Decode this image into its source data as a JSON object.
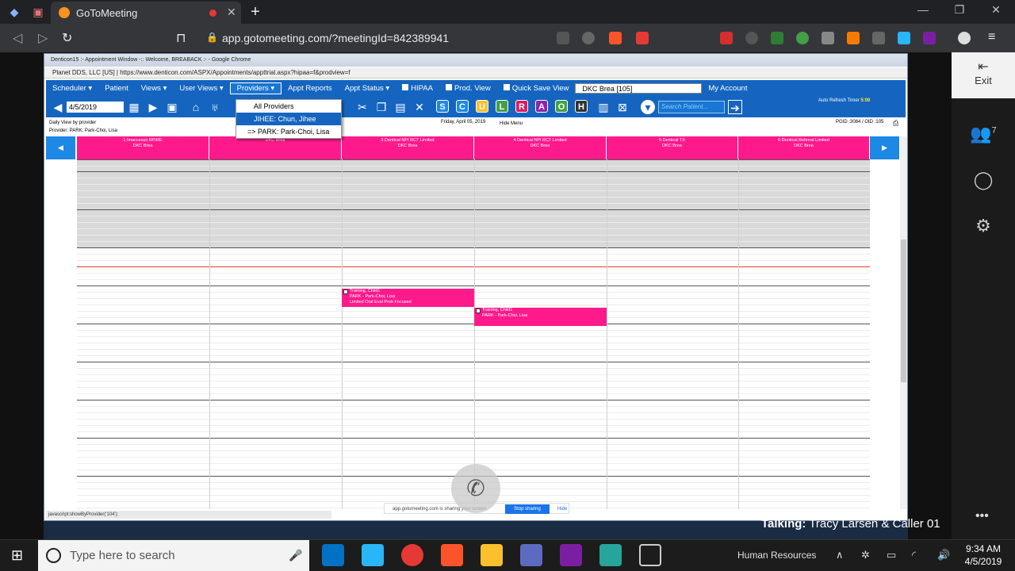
{
  "browser": {
    "tab_title": "GoToMeeting",
    "url": "app.gotomeeting.com/?meetingId=842389941"
  },
  "shared_window": {
    "title": "Denticon15 :- Appointment Window -:: Welcome, BREABACK :- - Google Chrome",
    "url": "Planet DDS, LLC [US]  |  https://www.denticon.com/ASPX/Appointments/appttrial.aspx?hipaa=f&prodview=f",
    "menu": {
      "scheduler": "Scheduler ▾",
      "patient": "Patient",
      "views": "Views ▾",
      "user_views": "User Views ▾",
      "providers": "Providers ▾",
      "appt_reports": "Appt Reports",
      "appt_status": "Appt Status ▾",
      "hipaa": "HIPAA",
      "prod_view": "Prod. View",
      "quick_save": "Quick Save View",
      "location": "DKC Brea [105]",
      "my_account": "My Account"
    },
    "toolbar": {
      "date": "4/5/2019",
      "search_placeholder": "Search Patient...",
      "auto_refresh_label": "Auto Refresh Timer",
      "auto_refresh_value": "5:00",
      "letters": [
        "S",
        "C",
        "U",
        "L",
        "R",
        "A",
        "O",
        "H"
      ]
    },
    "providers_dropdown": {
      "items": [
        "All Providers",
        "JIHEE: Chun, Jihee",
        "=> PARK: Park-Choi, Lisa"
      ],
      "highlighted_index": 1
    },
    "info": {
      "view": "Daily View by provider",
      "provider": "Provider: PARK: Park-Choi, Lisa",
      "date": "Friday, April 05, 2019",
      "hide_menu": "Hide Menu",
      "pgid": "PGID :3084 / OID :105"
    },
    "columns": [
      {
        "name": "1 Imaccesso NPIRE",
        "loc": "DKC Brea"
      },
      {
        "name": "",
        "loc": "DKC Brea"
      },
      {
        "name": "3 Dentical NPI RCT Limited",
        "loc": "DKC Brea"
      },
      {
        "name": "4 Dentical NPI RCT Limited",
        "loc": "DKC Brea"
      },
      {
        "name": "5 Dentical TX",
        "loc": "DKC Brea"
      },
      {
        "name": "6 Dentical Referral Limited",
        "loc": "DKC Brea"
      }
    ],
    "appointments": [
      {
        "line1": "Training, Child1",
        "line2": "PARK - Park-Choi, Lisa",
        "line3": "Limited Oral Eval Prob Focused"
      },
      {
        "line1": "Training, Child1",
        "line2": "PARK - Park-Choi, Lisa"
      }
    ],
    "status_js": "javascript:showByProvider('104');",
    "share_bar": {
      "text": "app.gotomeeting.com is sharing your screen.",
      "stop": "Stop sharing",
      "hide": "Hide"
    }
  },
  "gotomeeting": {
    "exit": "Exit",
    "attendees": "7",
    "talking_label": "Talking:",
    "talking_names": "Tracy Larsen & Caller 01"
  },
  "taskbar": {
    "search": "Type here to search",
    "hr": "Human Resources",
    "time": "9:34 AM",
    "date": "4/5/2019"
  }
}
